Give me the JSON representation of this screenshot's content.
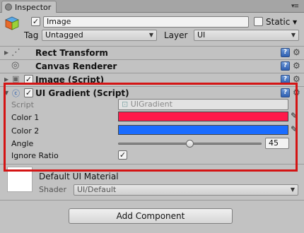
{
  "window": {
    "tab_title": "Inspector"
  },
  "object": {
    "active": true,
    "name": "Image",
    "static_label": "Static",
    "static_checked": false,
    "tag_label": "Tag",
    "tag_value": "Untagged",
    "layer_label": "Layer",
    "layer_value": "UI"
  },
  "components": [
    {
      "title": "Rect Transform"
    },
    {
      "title": "Canvas Renderer"
    },
    {
      "title": "Image (Script)",
      "enabled": true
    }
  ],
  "ui_gradient": {
    "title": "UI Gradient (Script)",
    "enabled": true,
    "script_label": "Script",
    "script_value": "UIGradient",
    "color1_label": "Color 1",
    "color1_value": "#ff1a4a",
    "color2_label": "Color 2",
    "color2_value": "#1a6cff",
    "angle_label": "Angle",
    "angle_value": "45",
    "angle_slider_fraction": 0.5,
    "ignore_ratio_label": "Ignore Ratio",
    "ignore_ratio_checked": true
  },
  "material": {
    "name": "Default UI Material",
    "shader_label": "Shader",
    "shader_value": "UI/Default"
  },
  "add_component_label": "Add Component",
  "colors": {
    "highlight": "#d41414",
    "panel_bg": "#c2c2c2"
  }
}
